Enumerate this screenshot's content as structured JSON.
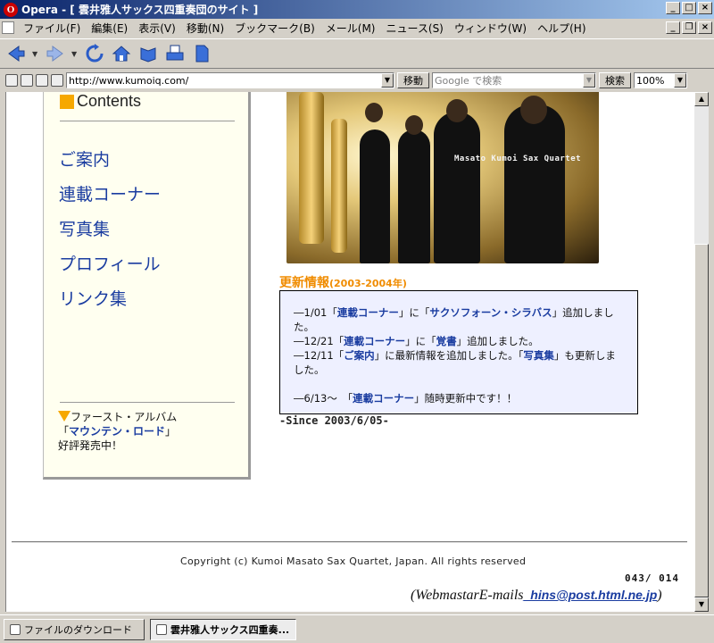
{
  "window": {
    "title": "Opera - [ 雲井雅人サックス四重奏団のサイト ]",
    "app_icon": "opera-icon"
  },
  "menu": [
    "ファイル(F)",
    "編集(E)",
    "表示(V)",
    "移動(N)",
    "ブックマーク(B)",
    "メール(M)",
    "ニュース(S)",
    "ウィンドウ(W)",
    "ヘルプ(H)"
  ],
  "toolbar": {
    "icons": [
      "back-icon",
      "forward-icon",
      "reload-icon",
      "home-icon",
      "hotlist-icon",
      "print-icon",
      "document-icon"
    ]
  },
  "address": {
    "url": "http://www.kumoiq.com/",
    "go_label": "移動",
    "search_placeholder": "Google で検索",
    "search_button": "検索",
    "zoom": "100%"
  },
  "nav": {
    "heading": "Contents",
    "links": [
      "ご案内",
      "連載コーナー",
      "写真集",
      "プロフィール",
      "リンク集"
    ],
    "album": {
      "line1": "ファースト・アルバム",
      "open_quote": "「",
      "link": "マウンテン・ロード",
      "close_quote": "」",
      "line3": "好評発売中！"
    }
  },
  "photo": {
    "caption": "Masato Kumoi Sax Quartet"
  },
  "news": {
    "heading": "更新情報",
    "heading_years": "(2003-2004年)",
    "items": [
      {
        "parts": [
          {
            "t": "―1/01「"
          },
          {
            "t": "連載コーナー",
            "link": true
          },
          {
            "t": "」に「"
          },
          {
            "t": "サクソフォーン・シラバス",
            "link": true
          },
          {
            "t": "」追加しました。"
          }
        ]
      },
      {
        "parts": [
          {
            "t": "―12/21「"
          },
          {
            "t": "連載コーナー",
            "link": true
          },
          {
            "t": "」に「"
          },
          {
            "t": "覚書",
            "link": true
          },
          {
            "t": "」追加しました。"
          }
        ]
      },
      {
        "parts": [
          {
            "t": "―12/11「"
          },
          {
            "t": "ご案内",
            "link": true
          },
          {
            "t": "」に最新情報を追加しました。「"
          },
          {
            "t": "写真集",
            "link": true
          },
          {
            "t": "」も更新しました。"
          }
        ]
      },
      {
        "parts": [
          {
            "t": "―6/13～　「"
          },
          {
            "t": "連載コーナー",
            "link": true
          },
          {
            "t": "」随時更新中です！！"
          }
        ]
      }
    ],
    "since": "-Since 2003/6/05-"
  },
  "footer": {
    "copyright": "Copyright (c) Kumoi Masato Sax Quartet, Japan. All rights reserved",
    "counter": "043/ 014",
    "webmaster_prefix": "(WebmastarE-mails",
    "email": "_hins@post.html.ne.jp",
    "webmaster_suffix": ")"
  },
  "taskbar": {
    "items": [
      {
        "label": "ファイルのダウンロード",
        "active": false
      },
      {
        "label": "雲井雅人サックス四重奏...",
        "active": true
      }
    ]
  }
}
